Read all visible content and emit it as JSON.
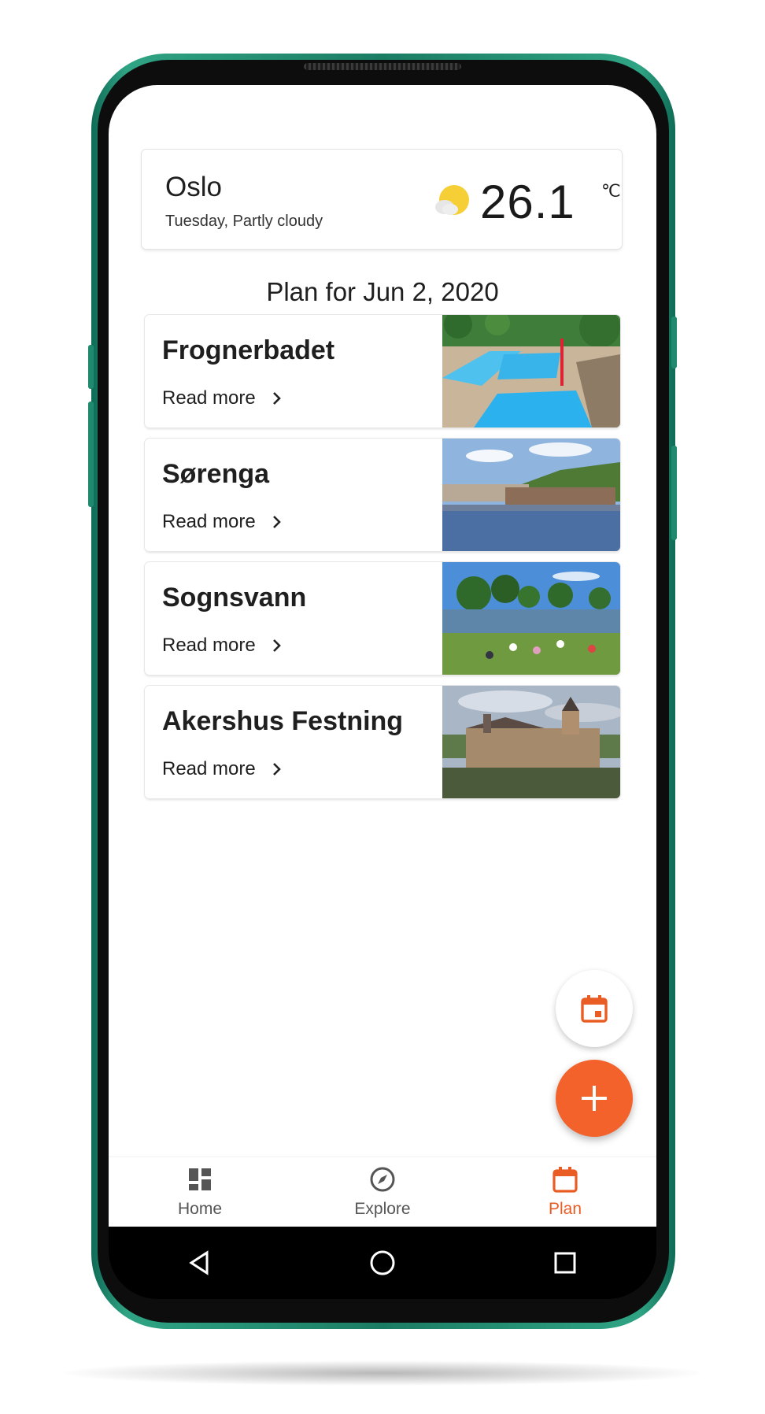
{
  "weather": {
    "city": "Oslo",
    "subtitle": "Tuesday, Partly cloudy",
    "temperature": "26.1",
    "unit": "℃",
    "icon": "partly-cloudy-icon"
  },
  "plan": {
    "title": "Plan for Jun 2, 2020",
    "items": [
      {
        "name": "Frognerbadet",
        "link": "Read more",
        "image": "outdoor-pool-photo"
      },
      {
        "name": "Sørenga",
        "link": "Read more",
        "image": "harbor-waterfront-photo"
      },
      {
        "name": "Sognsvann",
        "link": "Read more",
        "image": "lake-beach-crowd-photo"
      },
      {
        "name": "Akershus Festning",
        "link": "Read more",
        "image": "fortress-castle-photo"
      }
    ]
  },
  "fabs": {
    "calendar_icon": "calendar-icon",
    "add_icon": "plus-icon"
  },
  "nav": {
    "items": [
      {
        "label": "Home",
        "icon": "dashboard-icon"
      },
      {
        "label": "Explore",
        "icon": "compass-icon"
      },
      {
        "label": "Plan",
        "icon": "calendar-icon",
        "active": true
      }
    ]
  },
  "colors": {
    "accent": "#f4622c",
    "active_nav": "#e95c24",
    "frame": "#1f8a6d"
  }
}
